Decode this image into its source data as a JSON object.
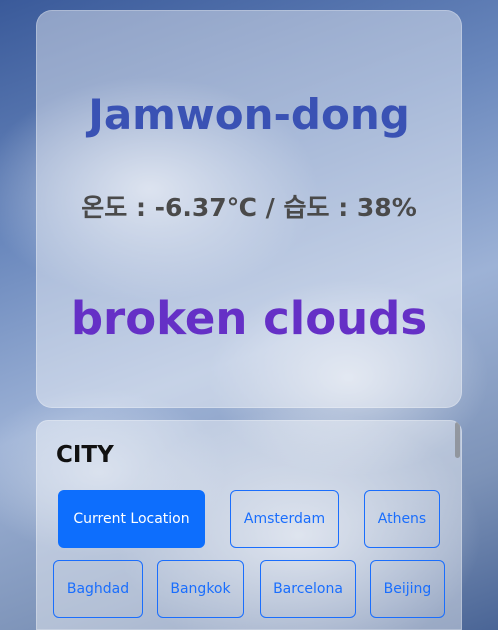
{
  "weather": {
    "location": "Jamwon-dong",
    "temperature_line": "온도 : -6.37℃ / 습도 : 38%",
    "condition": "broken clouds"
  },
  "cities": {
    "label": "CITY",
    "buttons": [
      "Current Location",
      "Amsterdam",
      "Athens",
      "Baghdad",
      "Bangkok",
      "Barcelona",
      "Beijing"
    ],
    "active": "Current Location"
  },
  "colors": {
    "location": "#3a52b4",
    "condition": "#6530c6",
    "accent": "#0d6efd"
  }
}
